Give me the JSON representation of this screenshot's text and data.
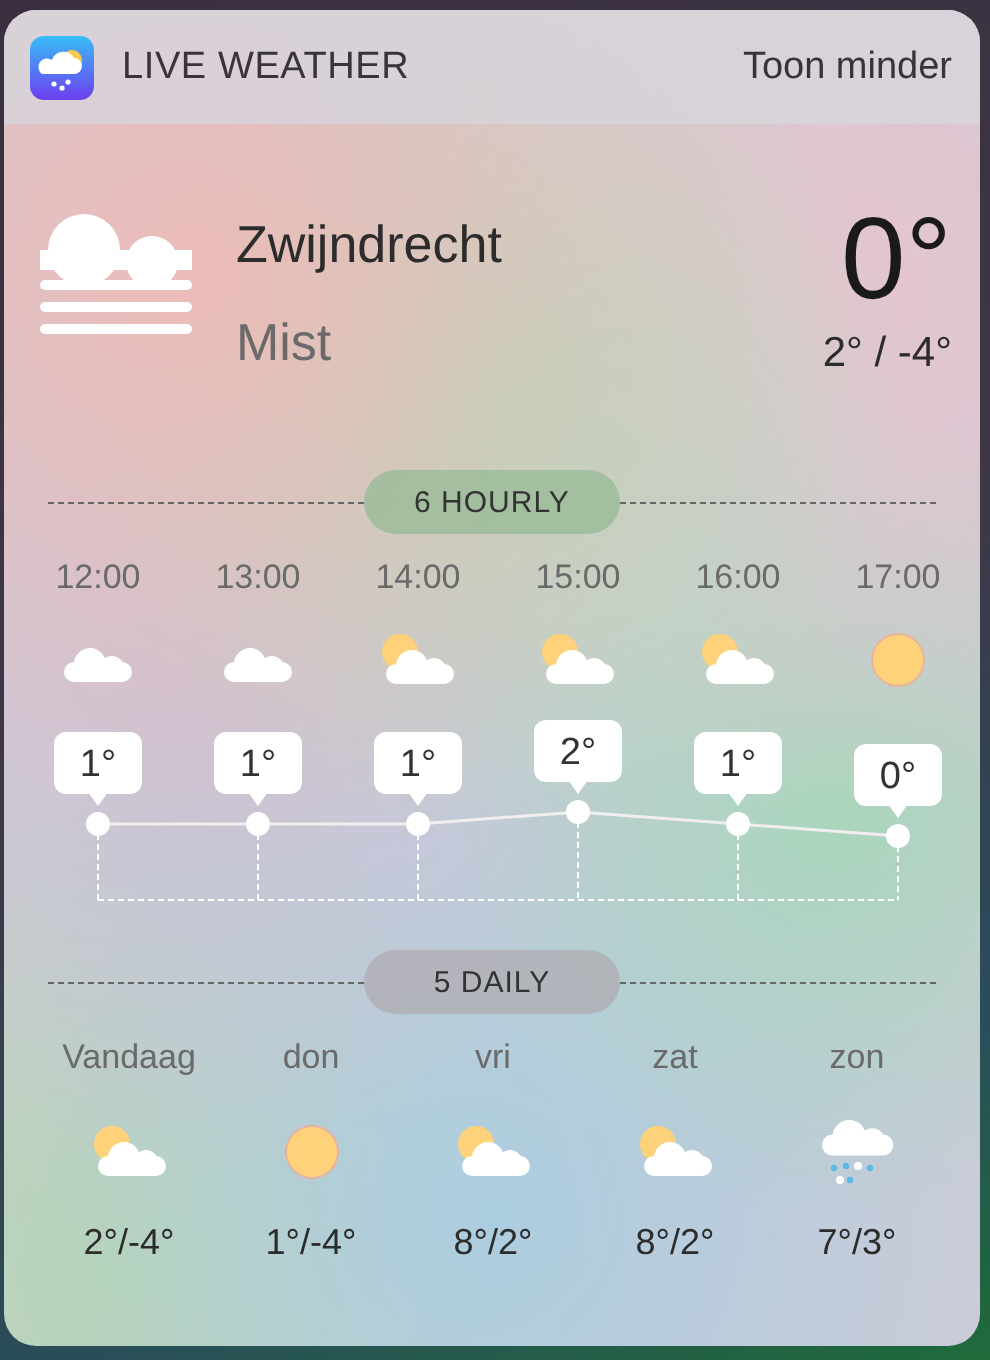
{
  "header": {
    "app_name": "LIVE WEATHER",
    "action": "Toon minder"
  },
  "current": {
    "city": "Zwijndrecht",
    "condition": "Mist",
    "kind": "fog",
    "temperature": "0°",
    "range": "2° / -4°"
  },
  "hourly": {
    "title": "6 HOURLY",
    "hours": [
      {
        "time": "12:00",
        "kind": "cloud",
        "temperature": "1°"
      },
      {
        "time": "13:00",
        "kind": "cloud",
        "temperature": "1°"
      },
      {
        "time": "14:00",
        "kind": "sun-cloud",
        "temperature": "1°"
      },
      {
        "time": "15:00",
        "kind": "sun-cloud",
        "temperature": "2°"
      },
      {
        "time": "16:00",
        "kind": "sun-cloud",
        "temperature": "1°"
      },
      {
        "time": "17:00",
        "kind": "sun",
        "temperature": "0°"
      }
    ]
  },
  "daily": {
    "title": "5 DAILY",
    "days": [
      {
        "day": "Vandaag",
        "kind": "sun-cloud",
        "range": "2°/-4°"
      },
      {
        "day": "don",
        "kind": "sun",
        "range": "1°/-4°"
      },
      {
        "day": "vri",
        "kind": "sun-cloud",
        "range": "8°/2°"
      },
      {
        "day": "zat",
        "kind": "sun-cloud",
        "range": "8°/2°"
      },
      {
        "day": "zon",
        "kind": "snow",
        "range": "7°/3°"
      }
    ]
  }
}
